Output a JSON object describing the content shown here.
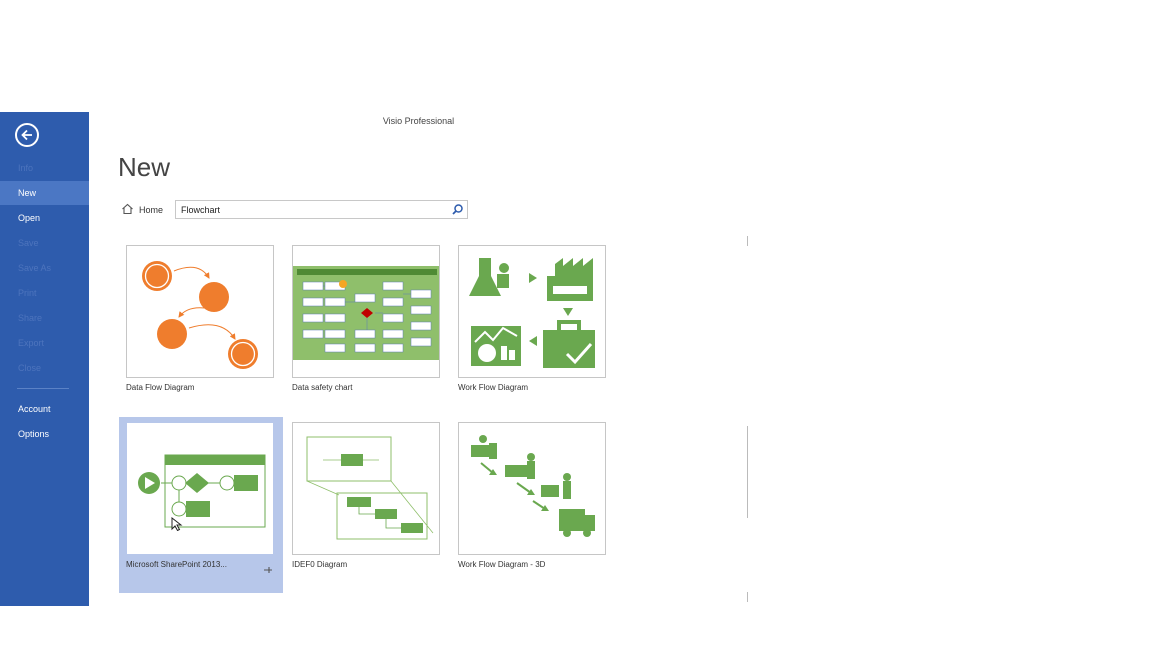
{
  "app": {
    "title": "Visio Professional"
  },
  "sidebar": {
    "items": [
      {
        "label": "Info",
        "enabled": false
      },
      {
        "label": "New",
        "enabled": true,
        "active": true
      },
      {
        "label": "Open",
        "enabled": true
      },
      {
        "label": "Save",
        "enabled": false
      },
      {
        "label": "Save As",
        "enabled": false
      },
      {
        "label": "Print",
        "enabled": false
      },
      {
        "label": "Share",
        "enabled": false
      },
      {
        "label": "Export",
        "enabled": false
      },
      {
        "label": "Close",
        "enabled": false
      }
    ],
    "bottom_items": [
      {
        "label": "Account"
      },
      {
        "label": "Options"
      }
    ]
  },
  "main": {
    "title": "New",
    "home_label": "Home",
    "search": {
      "value": "Flowchart"
    },
    "templates": [
      {
        "label": "Data Flow Diagram"
      },
      {
        "label": "Data safety chart"
      },
      {
        "label": "Work Flow Diagram"
      },
      {
        "label": "Microsoft SharePoint 2013...",
        "selected": true
      },
      {
        "label": "IDEF0 Diagram"
      },
      {
        "label": "Work Flow Diagram - 3D"
      }
    ]
  },
  "colors": {
    "sidebar": "#2e5cad",
    "accent_orange": "#ef7d2d",
    "accent_green": "#6aa84f",
    "selection": "#b7c7ea"
  }
}
